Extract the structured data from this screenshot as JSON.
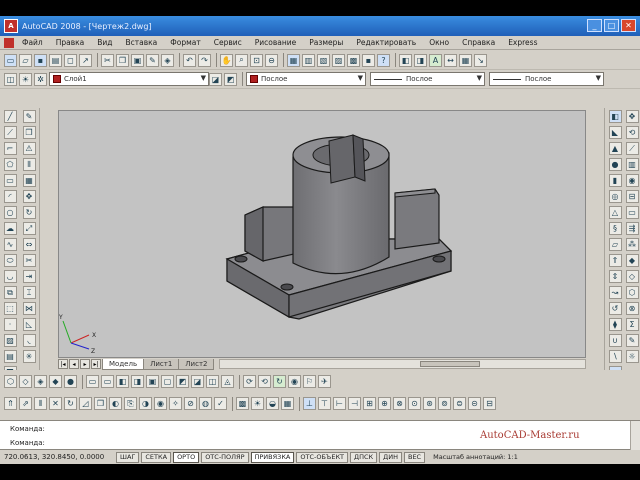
{
  "window": {
    "title": "AutoCAD 2008 - [Чертеж2.dwg]",
    "app_badge": "A"
  },
  "menu": {
    "items": [
      "Файл",
      "Правка",
      "Вид",
      "Вставка",
      "Формат",
      "Сервис",
      "Рисование",
      "Размеры",
      "Редактировать",
      "Окно",
      "Справка",
      "Express"
    ]
  },
  "properties_bar": {
    "layer_value": "Слой1",
    "color_value": "Послое",
    "linetype_value": "Послое",
    "lineweight_value": "Послое"
  },
  "layout_tabs": [
    "Модель",
    "Лист1",
    "Лист2"
  ],
  "command": {
    "line1": "Команда:",
    "line2": "Команда:"
  },
  "watermark": "AutoCAD-Master.ru",
  "status": {
    "coords": "720.0613, 320.8450, 0.0000",
    "buttons": [
      {
        "label": "ШАГ",
        "on": false
      },
      {
        "label": "СЕТКА",
        "on": false
      },
      {
        "label": "ОРТО",
        "on": true
      },
      {
        "label": "ОТС-ПОЛЯР",
        "on": false
      },
      {
        "label": "ПРИВЯЗКА",
        "on": true
      },
      {
        "label": "ОТС-ОБЪЕКТ",
        "on": false
      },
      {
        "label": "ДПСК",
        "on": false
      },
      {
        "label": "ДИН",
        "on": false
      },
      {
        "label": "ВЕС",
        "on": false
      }
    ],
    "annotation_scale": "Масштаб аннотаций: 1:1"
  },
  "colors": {
    "model_fill": "#7d7d80",
    "model_edge": "#1a1a1a",
    "canvas_bg": "#c3c3c3",
    "title_bar": "#2a70c8"
  }
}
